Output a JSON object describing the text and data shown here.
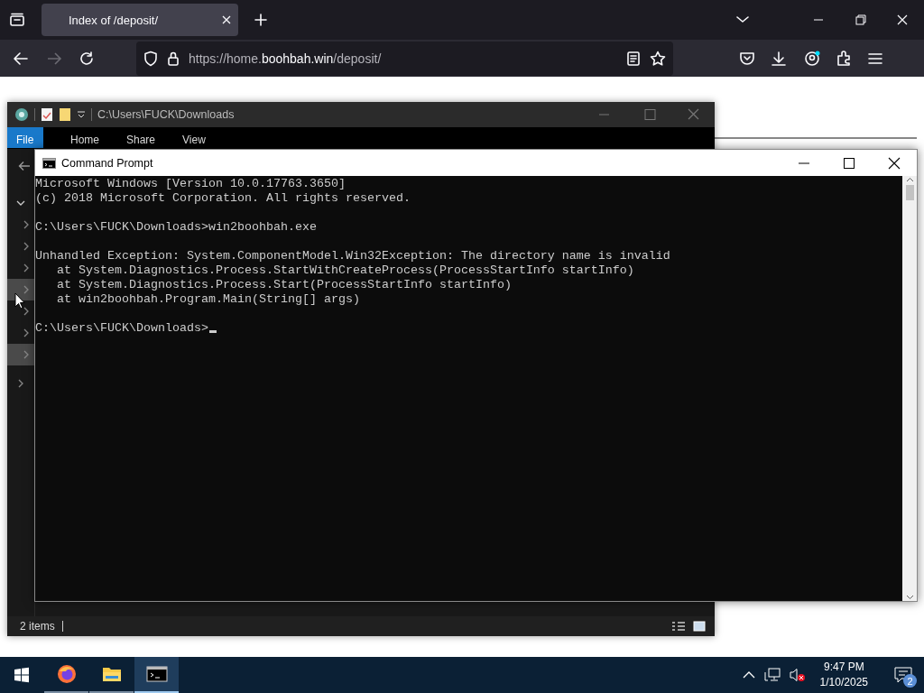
{
  "browser": {
    "tab": {
      "title": "Index of /deposit/"
    },
    "url": {
      "prefix": "https://home.",
      "domain": "boohbah.win",
      "path": "/deposit/"
    }
  },
  "explorer": {
    "title": "C:\\Users\\FUCK\\Downloads",
    "ribbon_tabs": [
      {
        "label": "File",
        "selected": true
      },
      {
        "label": "Home",
        "selected": false
      },
      {
        "label": "Share",
        "selected": false
      },
      {
        "label": "View",
        "selected": false
      }
    ],
    "nav_tree": [
      {
        "expanded": true,
        "highlighted": false,
        "children": [
          {
            "expanded": false,
            "highlighted": false
          },
          {
            "expanded": false,
            "highlighted": false
          },
          {
            "expanded": false,
            "highlighted": false
          },
          {
            "expanded": false,
            "highlighted": true
          },
          {
            "expanded": false,
            "highlighted": false
          },
          {
            "expanded": false,
            "highlighted": false
          },
          {
            "expanded": false,
            "highlighted": true
          }
        ]
      },
      {
        "expanded": false,
        "highlighted": false
      }
    ],
    "status": "2 items"
  },
  "cmd": {
    "title": "Command Prompt",
    "cursor": true,
    "blocks": [
      [
        "Microsoft Windows [Version 10.0.17763.3650]",
        "(c) 2018 Microsoft Corporation. All rights reserved."
      ],
      [
        "C:\\Users\\FUCK\\Downloads>win2boohbah.exe"
      ],
      [
        "Unhandled Exception: System.ComponentModel.Win32Exception: The directory name is invalid",
        "   at System.Diagnostics.Process.StartWithCreateProcess(ProcessStartInfo startInfo)",
        "   at System.Diagnostics.Process.Start(ProcessStartInfo startInfo)",
        "   at win2boohbah.Program.Main(String[] args)"
      ],
      [
        "C:\\Users\\FUCK\\Downloads>"
      ]
    ]
  },
  "taskbar": {
    "apps": [
      {
        "kind": "firefox",
        "selected": false
      },
      {
        "kind": "explorer",
        "selected": false
      },
      {
        "kind": "terminal",
        "selected": true
      }
    ],
    "time": "9:47 PM",
    "date": "1/10/2025",
    "notifications": "2"
  }
}
